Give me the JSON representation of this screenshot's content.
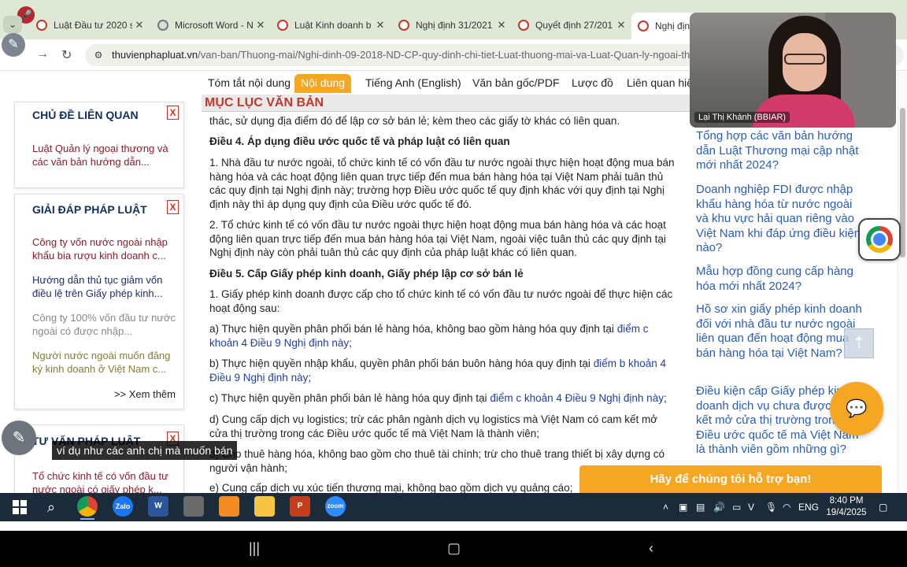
{
  "browser": {
    "tabs": [
      {
        "label": "Luật Đầu tư 2020 s",
        "icon": "site-favicon",
        "active": false
      },
      {
        "label": "Microsoft Word - N",
        "icon": "globe-icon",
        "active": false
      },
      {
        "label": "Luật Kinh doanh b",
        "icon": "site-favicon",
        "active": false
      },
      {
        "label": "Nghị định 31/2021",
        "icon": "site-favicon",
        "active": false
      },
      {
        "label": "Quyết định 27/201",
        "icon": "site-favicon",
        "active": false
      },
      {
        "label": "Nghị định",
        "icon": "site-favicon",
        "active": true
      }
    ],
    "url_domain": "thuvienphapluat.vn",
    "url_path": "/van-ban/Thuong-mai/Nghi-dinh-09-2018-ND-CP-quy-dinh-chi-tiet-Luat-thuong-mai-va-Luat-Quan-ly-ngoai-th"
  },
  "content_tabs": [
    "Tóm tắt nội dung",
    "Nội dung",
    "Tiếng Anh (English)",
    "Văn bản gốc/PDF",
    "Lược đồ",
    "Liên quan hiệ"
  ],
  "muc_luc": "MỤC LỤC VĂN BẢN",
  "sidebar": {
    "box1": {
      "title": "CHỦ ĐỀ LIÊN QUAN",
      "close": "X",
      "links": [
        "Luật Quản lý ngoại thương và các văn bản hướng dẫn..."
      ]
    },
    "box2": {
      "title": "GIẢI ĐÁP PHÁP LUẬT",
      "close": "X",
      "links": [
        "Công ty vốn nước ngoài nhập khẩu bia rượu kinh doanh c...",
        "Hướng dẫn thủ tục giảm vốn điều lệ trên Giấy phép kinh...",
        "Công ty 100% vốn đầu tư nước ngoài có được nhập...",
        "Người nước ngoài muốn đăng ký kinh doanh ở Việt Nam c..."
      ],
      "more": ">> Xem thêm"
    },
    "box3": {
      "title": "TƯ VẤN PHÁP LUẬT",
      "close": "X",
      "links": [
        "Tổ chức kinh tế có vốn đầu tư nước ngoài có giấy phép k..."
      ]
    }
  },
  "document": {
    "p0": "thác, sử dụng địa điểm đó để lập cơ sở bán lẻ; kèm theo các giấy tờ khác có liên quan.",
    "h4": "Điều 4. Áp dụng điều ước quốc tế và pháp luật có liên quan",
    "p4_1": "1. Nhà đầu tư nước ngoài, tổ chức kinh tế có vốn đầu tư nước ngoài thực hiện hoạt động mua bán hàng hóa và các hoạt động liên quan trực tiếp đến mua bán hàng hóa tại Việt Nam phải tuân thủ các quy định tại Nghị định này; trường hợp Điều ước quốc tế quy định khác với quy định tại Nghị định này thì áp dụng quy định của Điều ước quốc tế đó.",
    "p4_2": "2. Tổ chức kinh tế có vốn đầu tư nước ngoài thực hiện hoạt động mua bán hàng hóa và các hoạt động liên quan trực tiếp đến mua bán hàng hóa tại Việt Nam, ngoài việc tuân thủ các quy định tại Nghị định này còn phải tuân thủ các quy định của pháp luật khác có liên quan.",
    "h5": "Điều 5. Cấp Giấy phép kinh doanh, Giấy phép lập cơ sở bán lẻ",
    "p5_1": "1. Giấy phép kinh doanh được cấp cho tổ chức kinh tế có vốn đầu tư nước ngoài để thực hiện các hoạt động sau:",
    "pa_text": "a) Thực hiện quyền phân phối bán lẻ hàng hóa, không bao gồm hàng hóa quy định tại ",
    "pa_link": "điểm c khoản 4 Điều 9 Nghị định này",
    "pa_end": ";",
    "pb_text": "b) Thực hiện quyền nhập khẩu, quyền phân phối bán buôn hàng hóa quy định tại ",
    "pb_link": "điểm b khoản 4 Điều 9 Nghị định này",
    "pb_end": ";",
    "pc_text": "c) Thực hiện quyền phân phối bán lẻ hàng hóa quy định tại ",
    "pc_link": "điểm c khoản 4 Điều 9 Nghị định này",
    "pc_end": ";",
    "pd": "d) Cung cấp dịch vụ logistics; trừ các phân ngành dịch vụ logistics mà Việt Nam có cam kết mở cửa thị trường trong các Điều ước quốc tế mà Việt Nam là thành viên;",
    "pdd": "đ) Cho thuê hàng hóa, không bao gồm cho thuê tài chính; trừ cho thuê trang thiết bị xây dựng có người vận hành;",
    "pe": "e) Cung cấp dịch vụ xúc tiến thương mại, không bao gồm dịch vụ quảng cáo;"
  },
  "right_links": [
    "Tổng hợp các văn bản hướng dẫn Luật Thương mại cập nhật mới nhất 2024?",
    "Doanh nghiệp FDI được nhập khẩu hàng hóa từ nước ngoài và khu vực hải quan riêng vào Việt Nam khi đáp ứng điều kiện nào?",
    "Mẫu hợp đồng cung cấp hàng hóa mới nhất 2024?",
    "Hồ sơ xin giấy phép kinh doanh đối với nhà đầu tư nước ngoài liên quan đến hoạt động mua bán hàng hóa tại Việt Nam?",
    "Điều kiện cấp Giấy phép kinh doanh dịch vụ chưa được cam kết mở cửa thị trường trong các Điều ước quốc tế mà Việt Nam là thành viên gồm những gì?"
  ],
  "support_bar": "Hãy để chúng tôi hỗ trợ bạn!",
  "video": {
    "participant": "Lại Thị Khánh (BBIAR)"
  },
  "caption": "ví dụ như các anh chị mà muốn bán",
  "taskbar": {
    "apps": [
      "Chrome",
      "Zalo",
      "Word",
      "Paint",
      "Zoom clips",
      "Explorer",
      "PowerPoint",
      "Zoom"
    ],
    "zalo_label": "Zalo",
    "word_label": "W",
    "ppt_label": "P",
    "zoom_label": "zoom",
    "lang": "ENG",
    "time": "8:40 PM",
    "date": "19/4/2025"
  },
  "colors": {
    "accent_orange": "#f5a623",
    "heading_navy": "#123060",
    "link_blue": "#2a5db8",
    "taskbar": "#1c2b3a"
  }
}
